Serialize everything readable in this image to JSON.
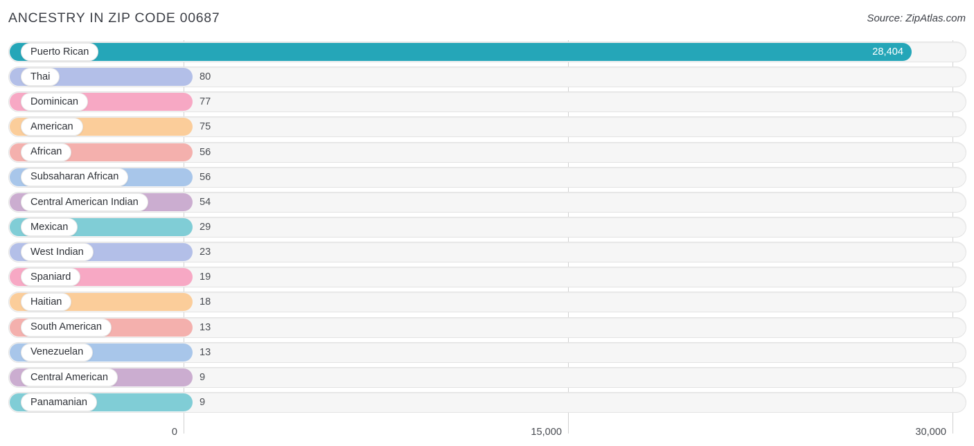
{
  "header": {
    "title": "ANCESTRY IN ZIP CODE 00687",
    "source": "Source: ZipAtlas.com"
  },
  "chart_data": {
    "type": "bar",
    "orientation": "horizontal",
    "title": "ANCESTRY IN ZIP CODE 00687",
    "xlabel": "",
    "ylabel": "",
    "xlim": [
      0,
      30000
    ],
    "grid": true,
    "legend": false,
    "xticks": [
      "0",
      "15,000",
      "30,000"
    ],
    "xtick_values": [
      0,
      15000,
      30000
    ],
    "categories": [
      "Puerto Rican",
      "Thai",
      "Dominican",
      "American",
      "African",
      "Subsaharan African",
      "Central American Indian",
      "Mexican",
      "West Indian",
      "Spaniard",
      "Haitian",
      "South American",
      "Venezuelan",
      "Central American",
      "Panamanian"
    ],
    "values": [
      28404,
      80,
      77,
      75,
      56,
      56,
      54,
      29,
      23,
      19,
      18,
      13,
      13,
      9,
      9
    ],
    "value_labels": [
      "28,404",
      "80",
      "77",
      "75",
      "56",
      "56",
      "54",
      "29",
      "23",
      "19",
      "18",
      "13",
      "13",
      "9",
      "9"
    ],
    "colors": [
      "#25a6b8",
      "#b3bfe8",
      "#f7a8c4",
      "#fbcd9a",
      "#f4b0ad",
      "#a8c6ea",
      "#cbadd0",
      "#80cdd6",
      "#b3bfe8",
      "#f7a8c4",
      "#fbcd9a",
      "#f4b0ad",
      "#a8c6ea",
      "#cbadd0",
      "#80cdd6"
    ]
  },
  "style": {
    "track_bg": "#f6f6f6",
    "track_border": "#e3e3e3",
    "grid_color": "#d0d0d0",
    "text_color": "#3c3f46",
    "value_color": "#4a4d53",
    "inside_value_color": "#ffffff"
  }
}
